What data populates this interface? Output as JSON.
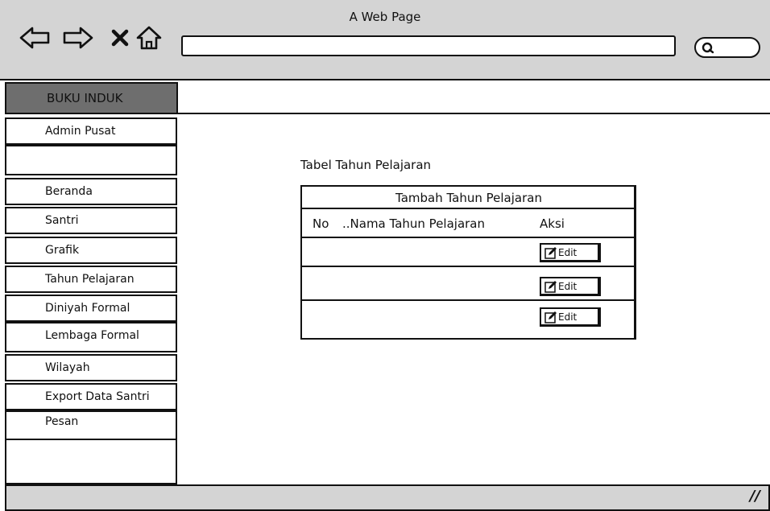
{
  "window": {
    "title": "A Web Page"
  },
  "toolbar": {
    "back_icon": "back-arrow-icon",
    "forward_icon": "forward-arrow-icon",
    "stop_icon": "close-icon",
    "home_icon": "home-icon",
    "address_value": "",
    "search_icon": "search-icon"
  },
  "brand": {
    "label": "BUKU INDUK"
  },
  "sidebar": {
    "items": [
      {
        "label": "Admin Pusat"
      },
      {
        "label": ""
      },
      {
        "label": "Beranda"
      },
      {
        "label": "Santri"
      },
      {
        "label": "Grafik"
      },
      {
        "label": "Tahun Pelajaran"
      },
      {
        "label": "Diniyah Formal"
      },
      {
        "label": "Lembaga Formal"
      },
      {
        "label": "Wilayah"
      },
      {
        "label": "Export Data Santri"
      },
      {
        "label": "Pesan"
      }
    ]
  },
  "main": {
    "heading": "Tabel Tahun Pelajaran",
    "add_button_label": "Tambah Tahun Pelajaran",
    "columns": [
      "No",
      "..Nama Tahun Pelajaran",
      "Aksi"
    ],
    "rows": [
      {
        "no": "",
        "nama": "",
        "action_label": "Edit"
      },
      {
        "no": "",
        "nama": "",
        "action_label": "Edit"
      },
      {
        "no": "",
        "nama": "",
        "action_label": "Edit"
      }
    ],
    "edit_icon": "edit-pencil-icon"
  },
  "footer": {
    "grip_label": "//"
  }
}
